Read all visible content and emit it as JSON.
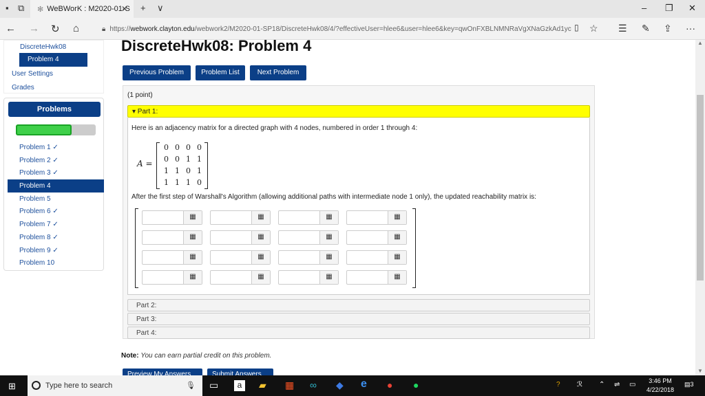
{
  "browser": {
    "tab_title": "WeBWorK : M2020-01-S",
    "url_scheme": "https://",
    "url_host": "webwork.clayton.edu",
    "url_path": "/webwork2/M2020-01-SP18/DiscreteHwk08/4/?effectiveUser=hlee6&user=hlee6&key=qwOnFXBLNMNRaVgXNaGzkAd1yc"
  },
  "sidebar": {
    "set_link": "DiscreteHwk08",
    "current_problem": "Problem 4",
    "user_settings": "User Settings",
    "grades": "Grades",
    "problems_header": "Problems",
    "progress_fraction": 0.7,
    "problems": [
      {
        "label": "Problem 1 ✓",
        "active": false
      },
      {
        "label": "Problem 2 ✓",
        "active": false
      },
      {
        "label": "Problem 3 ✓",
        "active": false
      },
      {
        "label": "Problem 4",
        "active": true
      },
      {
        "label": "Problem 5",
        "active": false
      },
      {
        "label": "Problem 6 ✓",
        "active": false
      },
      {
        "label": "Problem 7 ✓",
        "active": false
      },
      {
        "label": "Problem 8 ✓",
        "active": false
      },
      {
        "label": "Problem 9 ✓",
        "active": false
      },
      {
        "label": "Problem 10",
        "active": false
      }
    ]
  },
  "main": {
    "title": "DiscreteHwk08: Problem 4",
    "prev_button": "Previous Problem",
    "list_button": "Problem List",
    "next_button": "Next Problem",
    "points": "(1 point)",
    "part1_label": "▾ Part 1:",
    "question_text": "Here is an adjacency matrix for a directed graph with 4 nodes, numbered in order 1 through 4:",
    "matrix_label": "A =",
    "matrix": [
      [
        "0",
        "0",
        "0",
        "0"
      ],
      [
        "0",
        "0",
        "1",
        "1"
      ],
      [
        "1",
        "1",
        "0",
        "1"
      ],
      [
        "1",
        "1",
        "1",
        "0"
      ]
    ],
    "followup_text": "After the first step of Warshall's Algorithm (allowing additional paths with intermediate node 1 only), the updated reachability matrix is:",
    "part2_label": "Part 2:",
    "part3_label": "Part 3:",
    "part4_label": "Part 4:",
    "note_label": "Note:",
    "note_text": "You can earn partial credit on this problem.",
    "preview_button": "Preview My Answers",
    "submit_button": "Submit Answers"
  },
  "taskbar": {
    "search_placeholder": "Type here to search",
    "time": "3:46 PM",
    "date": "4/22/2018",
    "notification_count": "3"
  },
  "colors": {
    "accent": "#0b3f87",
    "part_highlight": "#ffff00",
    "progress_green": "#3fd04a"
  }
}
